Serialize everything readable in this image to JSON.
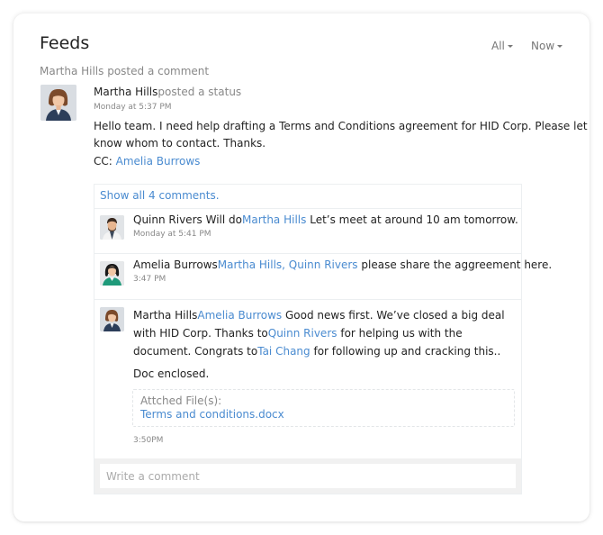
{
  "header": {
    "title": "Feeds",
    "filter_all": "All",
    "filter_now": "Now"
  },
  "activity": "Martha Hills posted a comment",
  "post": {
    "author": "Martha Hills",
    "action": "posted a status",
    "time": "Monday at 5:37 PM",
    "text": "Hello team. I need help drafting a Terms and Conditions agreement for HID Corp. Please let know whom to contact. Thanks.",
    "cc_label": "CC:",
    "cc_name": "Amelia Burrows"
  },
  "comments": {
    "show_all": "Show all 4 comments.",
    "items": [
      {
        "author": "Quinn Rivers",
        "text_before": "Will do",
        "mention": "Martha Hills",
        "text_after": "Let’s meet at around 10 am tomorrow.",
        "time": "Monday at 5:41 PM"
      },
      {
        "author": "Amelia Burrows",
        "mention": "Martha Hills, Quinn Rivers",
        "text_after": "please share the aggreement here.",
        "time": "3:47 PM"
      },
      {
        "author": "Martha Hills",
        "mention": "Amelia Burrows",
        "text_1": "Good news first. We’ve closed a big deal with HID Corp. Thanks to",
        "mention_2": "Quinn Rivers",
        "text_2": "for helping us with the document. Congrats to",
        "mention_3": "Tai Chang",
        "text_3": "for following up and cracking this..",
        "doc_line": "Doc enclosed.",
        "attach_label": "Attched File(s):",
        "attach_file": "Terms and conditions.docx",
        "time": "3:50PM"
      }
    ]
  },
  "compose": {
    "placeholder": "Write a comment"
  },
  "colors": {
    "link": "#4a8bd0",
    "muted": "#888888",
    "compose_bg": "#f1f1f1"
  }
}
